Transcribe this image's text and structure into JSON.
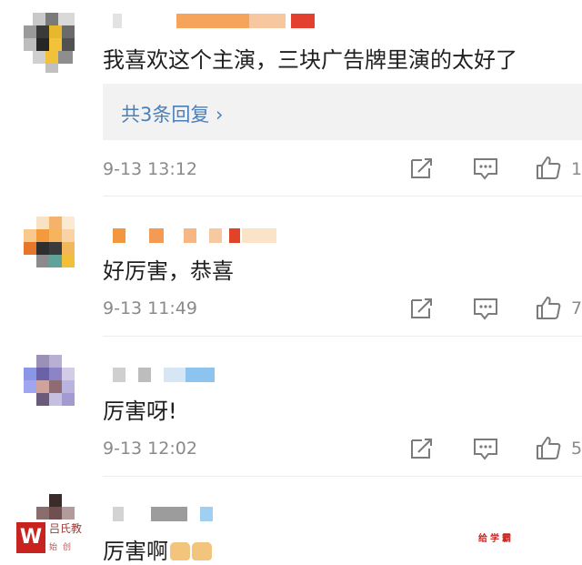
{
  "comments": [
    {
      "text": "我喜欢这个主演，三块广告牌里演的太好了",
      "reply_link": "共3条回复 ›",
      "time": "9-13 13:12",
      "likes": "1"
    },
    {
      "text": "好厉害，恭喜",
      "time": "9-13 11:49",
      "likes": "7"
    },
    {
      "text": "厉害呀!",
      "time": "9-13 12:02",
      "likes": "5"
    },
    {
      "text": "厉害啊"
    }
  ],
  "watermark": {
    "logo": "W",
    "line1": "吕氏教",
    "line2": "始创",
    "right": "给学霸"
  },
  "icons": {
    "share": "share-icon",
    "comment": "comment-icon",
    "like": "thumbs-up-icon",
    "emoji": "thumbs-up-emoji"
  }
}
